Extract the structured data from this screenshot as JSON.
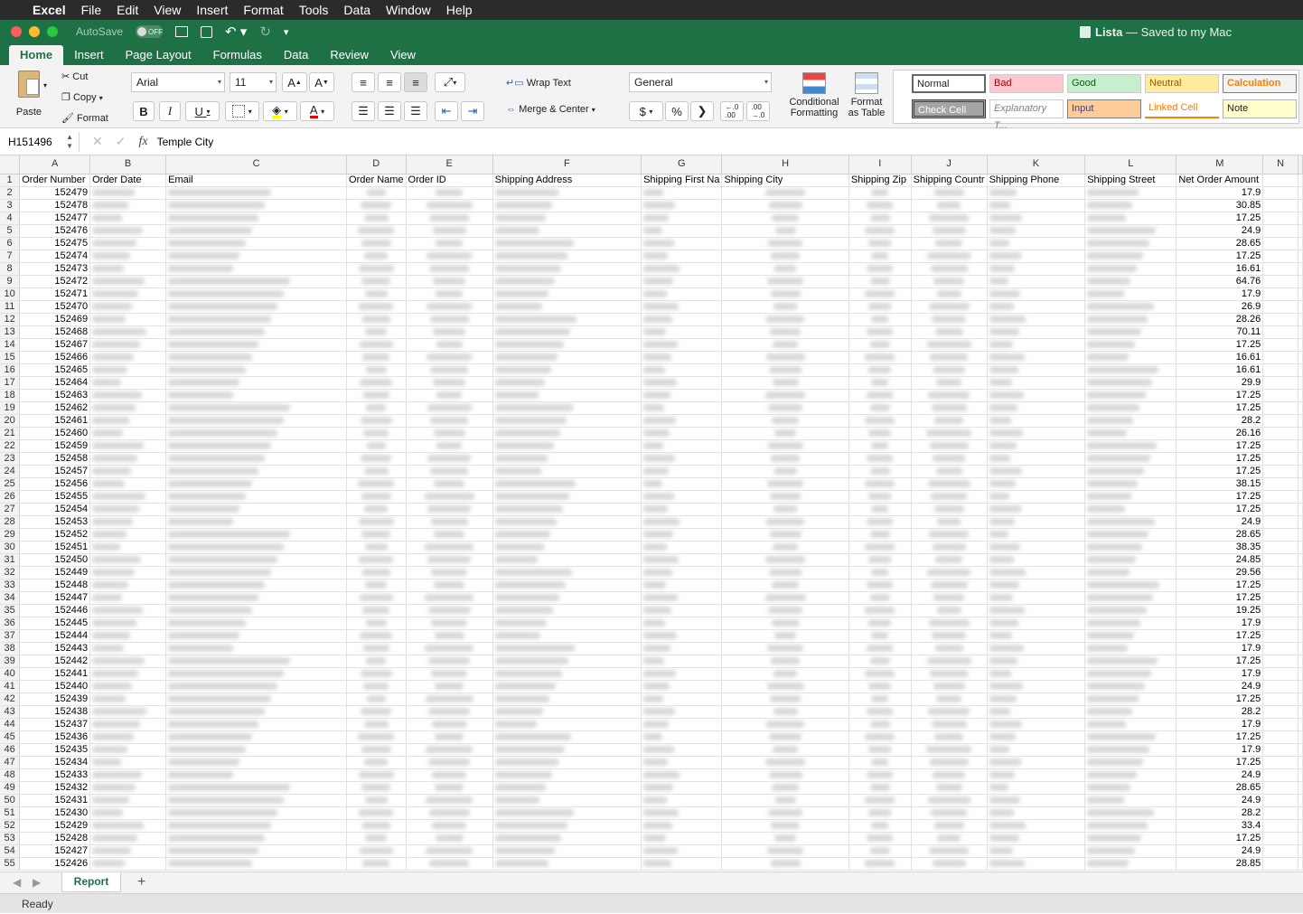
{
  "menubar": {
    "app": "Excel",
    "items": [
      "File",
      "Edit",
      "View",
      "Insert",
      "Format",
      "Tools",
      "Data",
      "Window",
      "Help"
    ]
  },
  "titlebar": {
    "autosave_label": "AutoSave",
    "autosave_state": "OFF",
    "doc_name": "Lista",
    "doc_status": "— Saved to my Mac"
  },
  "tabs": [
    "Home",
    "Insert",
    "Page Layout",
    "Formulas",
    "Data",
    "Review",
    "View"
  ],
  "ribbon": {
    "paste": "Paste",
    "cut": "Cut",
    "copy": "Copy",
    "format": "Format",
    "font_name": "Arial",
    "font_size": "11",
    "bold": "B",
    "italic": "I",
    "underline": "U",
    "wrap_text": "Wrap Text",
    "merge_center": "Merge & Center",
    "number_format": "General",
    "currency": "$",
    "percent": "%",
    "comma": "❯",
    "cond_format_1": "Conditional",
    "cond_format_2": "Formatting",
    "format_table_1": "Format",
    "format_table_2": "as Table",
    "styles": [
      {
        "label": "Normal",
        "bg": "#ffffff",
        "fg": "#000000"
      },
      {
        "label": "Bad",
        "bg": "#ffc7ce",
        "fg": "#9c0006"
      },
      {
        "label": "Good",
        "bg": "#c6efce",
        "fg": "#006100"
      },
      {
        "label": "Neutral",
        "bg": "#ffeb9c",
        "fg": "#9c5700"
      },
      {
        "label": "Calculation",
        "bg": "#f2f2f2",
        "fg": "#fa7d00"
      },
      {
        "label": "Check Cell",
        "bg": "#a5a5a5",
        "fg": "#ffffff"
      },
      {
        "label": "Explanatory T...",
        "bg": "#ffffff",
        "fg": "#7f7f7f"
      },
      {
        "label": "Input",
        "bg": "#ffcc99",
        "fg": "#3f3f76"
      },
      {
        "label": "Linked Cell",
        "bg": "#ffffff",
        "fg": "#fa7d00"
      },
      {
        "label": "Note",
        "bg": "#ffffcc",
        "fg": "#000000"
      }
    ]
  },
  "formula_bar": {
    "cell_ref": "H151496",
    "content": "Temple City",
    "fx": "fx"
  },
  "sheet": {
    "columns": [
      "A",
      "B",
      "C",
      "D",
      "E",
      "F",
      "G",
      "H",
      "I",
      "J",
      "K",
      "L",
      "M",
      "N"
    ],
    "headers": [
      "Order Number",
      "Order Date",
      "Email",
      "Order Name",
      "Order ID",
      "Shipping Address",
      "Shipping First Na",
      "Shipping City",
      "Shipping Zip",
      "Shipping Countr",
      "Shipping Phone",
      "Shipping Street",
      "Net Order Amount",
      ""
    ],
    "rows": [
      [
        "152479",
        "17.9"
      ],
      [
        "152478",
        "30.85"
      ],
      [
        "152477",
        "17.25"
      ],
      [
        "152476",
        "24.9"
      ],
      [
        "152475",
        "28.65"
      ],
      [
        "152474",
        "17.25"
      ],
      [
        "152473",
        "16.61"
      ],
      [
        "152472",
        "64.76"
      ],
      [
        "152471",
        "17.9"
      ],
      [
        "152470",
        "26.9"
      ],
      [
        "152469",
        "28.26"
      ],
      [
        "152468",
        "70.11"
      ],
      [
        "152467",
        "17.25"
      ],
      [
        "152466",
        "16.61"
      ],
      [
        "152465",
        "16.61"
      ],
      [
        "152464",
        "29.9"
      ],
      [
        "152463",
        "17.25"
      ],
      [
        "152462",
        "17.25"
      ],
      [
        "152461",
        "28.2"
      ],
      [
        "152460",
        "26.16"
      ],
      [
        "152459",
        "17.25"
      ],
      [
        "152458",
        "17.25"
      ],
      [
        "152457",
        "17.25"
      ],
      [
        "152456",
        "38.15"
      ],
      [
        "152455",
        "17.25"
      ],
      [
        "152454",
        "17.25"
      ],
      [
        "152453",
        "24.9"
      ],
      [
        "152452",
        "28.65"
      ],
      [
        "152451",
        "38.35"
      ],
      [
        "152450",
        "24.85"
      ],
      [
        "152449",
        "29.56"
      ],
      [
        "152448",
        "17.25"
      ],
      [
        "152447",
        "17.25"
      ],
      [
        "152446",
        "19.25"
      ],
      [
        "152445",
        "17.9"
      ],
      [
        "152444",
        "17.25"
      ],
      [
        "152443",
        "17.9"
      ],
      [
        "152442",
        "17.25"
      ],
      [
        "152441",
        "17.9"
      ],
      [
        "152440",
        "24.9"
      ],
      [
        "152439",
        "17.25"
      ],
      [
        "152438",
        "28.2"
      ],
      [
        "152437",
        "17.9"
      ],
      [
        "152436",
        "17.25"
      ],
      [
        "152435",
        "17.9"
      ],
      [
        "152434",
        "17.25"
      ],
      [
        "152433",
        "24.9"
      ],
      [
        "152432",
        "28.65"
      ],
      [
        "152431",
        "24.9"
      ],
      [
        "152430",
        "28.2"
      ],
      [
        "152429",
        "33.4"
      ],
      [
        "152428",
        "17.25"
      ],
      [
        "152427",
        "24.9"
      ],
      [
        "152426",
        "28.85"
      ]
    ]
  },
  "sheet_tabs": {
    "active": "Report",
    "add": "+"
  },
  "status": "Ready"
}
